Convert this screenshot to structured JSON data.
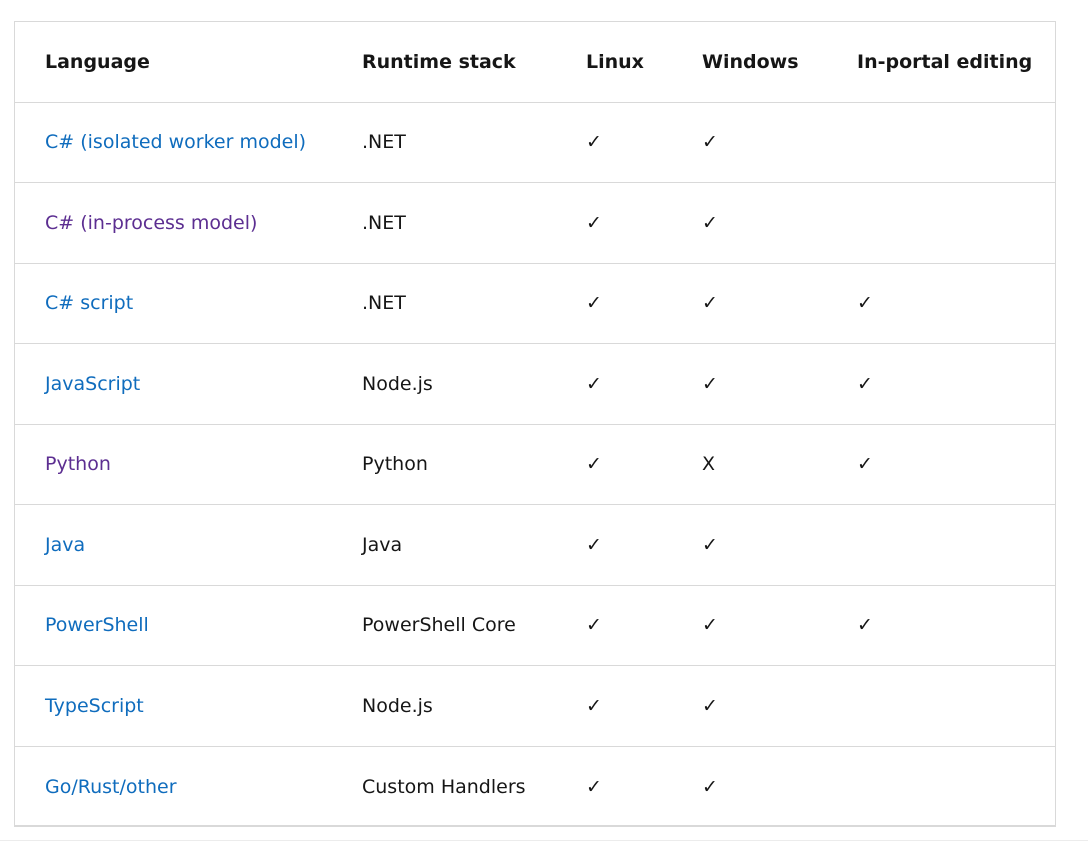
{
  "table": {
    "headers": {
      "language": "Language",
      "runtime_stack": "Runtime stack",
      "linux": "Linux",
      "windows": "Windows",
      "in_portal_editing": "In-portal editing"
    },
    "rows": [
      {
        "language": "C# (isolated worker model)",
        "visited": false,
        "runtime_stack": ".NET",
        "linux": "✓",
        "windows": "✓",
        "in_portal_editing": ""
      },
      {
        "language": "C# (in-process model)",
        "visited": true,
        "runtime_stack": ".NET",
        "linux": "✓",
        "windows": "✓",
        "in_portal_editing": ""
      },
      {
        "language": "C# script",
        "visited": false,
        "runtime_stack": ".NET",
        "linux": "✓",
        "windows": "✓",
        "in_portal_editing": "✓"
      },
      {
        "language": "JavaScript",
        "visited": false,
        "runtime_stack": "Node.js",
        "linux": "✓",
        "windows": "✓",
        "in_portal_editing": "✓"
      },
      {
        "language": "Python",
        "visited": true,
        "runtime_stack": "Python",
        "linux": "✓",
        "windows": "X",
        "in_portal_editing": "✓"
      },
      {
        "language": "Java",
        "visited": false,
        "runtime_stack": "Java",
        "linux": "✓",
        "windows": "✓",
        "in_portal_editing": ""
      },
      {
        "language": "PowerShell",
        "visited": false,
        "runtime_stack": "PowerShell Core",
        "linux": "✓",
        "windows": "✓",
        "in_portal_editing": "✓"
      },
      {
        "language": "TypeScript",
        "visited": false,
        "runtime_stack": "Node.js",
        "linux": "✓",
        "windows": "✓",
        "in_portal_editing": ""
      },
      {
        "language": "Go/Rust/other",
        "visited": false,
        "runtime_stack": "Custom Handlers",
        "linux": "✓",
        "windows": "✓",
        "in_portal_editing": ""
      }
    ]
  },
  "colors": {
    "link": "#0f6cbd",
    "visited_link": "#5c2e91",
    "border": "#d9d9d9",
    "text": "#161616"
  }
}
